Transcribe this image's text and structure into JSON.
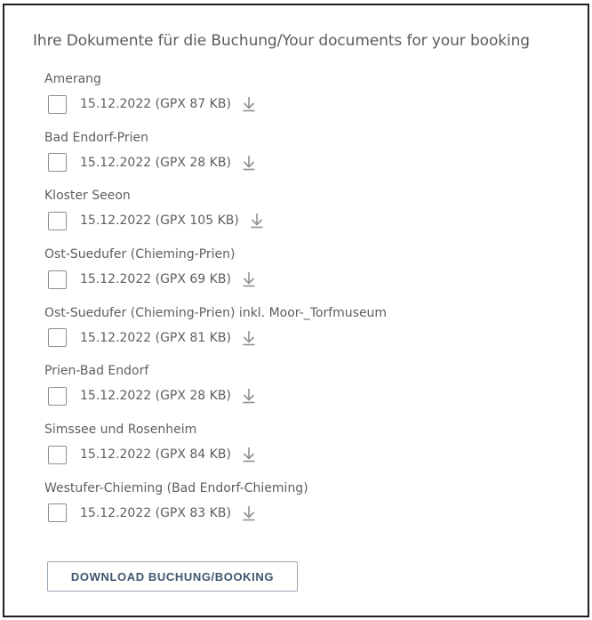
{
  "title": "Ihre Dokumente für die Buchung/Your documents for your booking",
  "documents": [
    {
      "name": "Amerang",
      "file_info": "15.12.2022 (GPX 87 KB)"
    },
    {
      "name": "Bad Endorf-Prien",
      "file_info": "15.12.2022 (GPX 28 KB)"
    },
    {
      "name": "Kloster Seeon",
      "file_info": "15.12.2022 (GPX 105 KB)"
    },
    {
      "name": "Ost-Suedufer (Chieming-Prien)",
      "file_info": "15.12.2022 (GPX 69 KB)"
    },
    {
      "name": "Ost-Suedufer (Chieming-Prien) inkl. Moor-_Torfmuseum",
      "file_info": "15.12.2022 (GPX 81 KB)"
    },
    {
      "name": "Prien-Bad Endorf",
      "file_info": "15.12.2022 (GPX 28 KB)"
    },
    {
      "name": "Simssee und Rosenheim",
      "file_info": "15.12.2022 (GPX 84 KB)"
    },
    {
      "name": "Westufer-Chieming (Bad Endorf-Chieming)",
      "file_info": "15.12.2022 (GPX 83 KB)"
    }
  ],
  "download_button_label": "DOWNLOAD BUCHUNG/BOOKING",
  "icons": {
    "download": "download-arrow-icon"
  },
  "colors": {
    "text": "#5e5e5e",
    "icon": "#8f8f8f",
    "button_text": "#3f5670",
    "button_border": "#9aa7b5"
  }
}
